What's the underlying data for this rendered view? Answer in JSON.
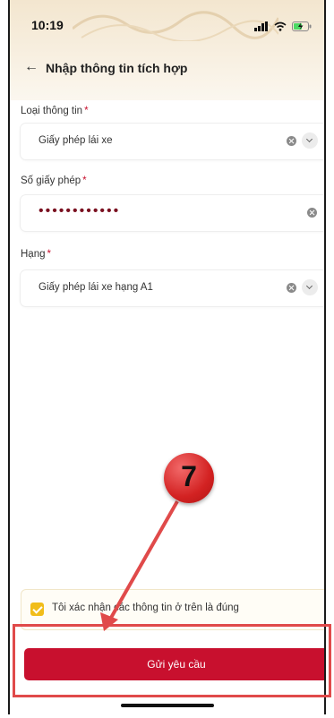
{
  "status_bar": {
    "time": "10:19"
  },
  "nav": {
    "title": "Nhập thông tin tích hợp"
  },
  "form": {
    "fields": [
      {
        "label": "Loại thông tin",
        "required_mark": "*",
        "value": "Giấy phép lái xe"
      },
      {
        "label": "Số giấy phép",
        "required_mark": "*",
        "value": "••••••••••••"
      },
      {
        "label": "Hạng",
        "required_mark": "*",
        "value": "Giấy phép lái xe hạng A1"
      }
    ],
    "confirm_text": "Tôi xác nhận các thông tin ở trên là đúng",
    "confirm_checked": true,
    "submit_label": "Gửi yêu cầu"
  },
  "annotation": {
    "step_number": "7"
  },
  "colors": {
    "brand_red": "#c8102e",
    "checkbox_yellow": "#f1bd1a",
    "annotation_red": "#e04a4a"
  }
}
